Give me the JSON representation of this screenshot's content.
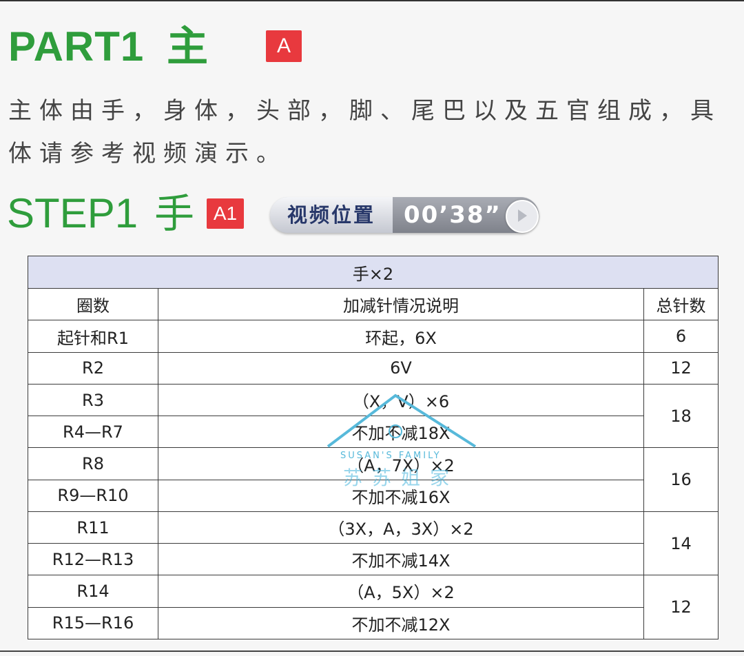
{
  "part": {
    "title": "PART1",
    "char": "主",
    "badge": "A"
  },
  "description": {
    "line1": "主体由手，身体，头部，脚、尾巴以及五官组成，具",
    "line2": "体请参考视频演示。"
  },
  "step": {
    "title": "STEP1",
    "char": "手",
    "badge": "A1",
    "video_label": "视频位置",
    "video_time": "00’38”"
  },
  "table": {
    "caption": "手×2",
    "headers": [
      "圈数",
      "加减针情况说明",
      "总针数"
    ],
    "rows": [
      {
        "round": "起针和R1",
        "desc": "环起，6X",
        "total": "6"
      },
      {
        "round": "R2",
        "desc": "6V",
        "total": "12"
      },
      {
        "round": "R3",
        "desc": "（X，V）×6",
        "total": "18"
      },
      {
        "round": "R4—R7",
        "desc": "不加不减18X"
      },
      {
        "round": "R8",
        "desc": "（A，7X）×2",
        "total": "16"
      },
      {
        "round": "R9—R10",
        "desc": "不加不减16X"
      },
      {
        "round": "R11",
        "desc": "（3X，A，3X）×2",
        "total": "14"
      },
      {
        "round": "R12—R13",
        "desc": "不加不减14X"
      },
      {
        "round": "R14",
        "desc": "（A，5X）×2",
        "total": "12"
      },
      {
        "round": "R15—R16",
        "desc": "不加不减12X"
      }
    ]
  },
  "watermark": {
    "text_en": "SUSAN'S FAMILY",
    "text_cn": "苏苏姐家"
  },
  "colors": {
    "green": "#2f9d3c",
    "red": "#e8393e",
    "caption_bg": "#dde0f2",
    "watermark": "#57b9da"
  },
  "icons": {
    "play": "play-icon"
  }
}
